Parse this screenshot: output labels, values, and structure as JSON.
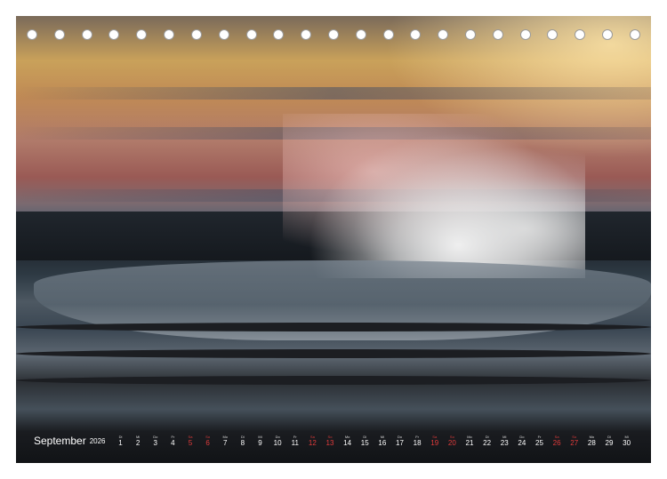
{
  "calendar": {
    "month": "September",
    "year": "2026",
    "days": [
      {
        "num": "1",
        "wd": "Di",
        "weekend": false
      },
      {
        "num": "2",
        "wd": "Mi",
        "weekend": false
      },
      {
        "num": "3",
        "wd": "Do",
        "weekend": false
      },
      {
        "num": "4",
        "wd": "Fr",
        "weekend": false
      },
      {
        "num": "5",
        "wd": "Sa",
        "weekend": true
      },
      {
        "num": "6",
        "wd": "So",
        "weekend": true
      },
      {
        "num": "7",
        "wd": "Mo",
        "weekend": false
      },
      {
        "num": "8",
        "wd": "Di",
        "weekend": false
      },
      {
        "num": "9",
        "wd": "Mi",
        "weekend": false
      },
      {
        "num": "10",
        "wd": "Do",
        "weekend": false
      },
      {
        "num": "11",
        "wd": "Fr",
        "weekend": false
      },
      {
        "num": "12",
        "wd": "Sa",
        "weekend": true
      },
      {
        "num": "13",
        "wd": "So",
        "weekend": true
      },
      {
        "num": "14",
        "wd": "Mo",
        "weekend": false
      },
      {
        "num": "15",
        "wd": "Di",
        "weekend": false
      },
      {
        "num": "16",
        "wd": "Mi",
        "weekend": false
      },
      {
        "num": "17",
        "wd": "Do",
        "weekend": false
      },
      {
        "num": "18",
        "wd": "Fr",
        "weekend": false
      },
      {
        "num": "19",
        "wd": "Sa",
        "weekend": true
      },
      {
        "num": "20",
        "wd": "So",
        "weekend": true
      },
      {
        "num": "21",
        "wd": "Mo",
        "weekend": false
      },
      {
        "num": "22",
        "wd": "Di",
        "weekend": false
      },
      {
        "num": "23",
        "wd": "Mi",
        "weekend": false
      },
      {
        "num": "24",
        "wd": "Do",
        "weekend": false
      },
      {
        "num": "25",
        "wd": "Fr",
        "weekend": false
      },
      {
        "num": "26",
        "wd": "Sa",
        "weekend": true
      },
      {
        "num": "27",
        "wd": "So",
        "weekend": true
      },
      {
        "num": "28",
        "wd": "Mo",
        "weekend": false
      },
      {
        "num": "29",
        "wd": "Di",
        "weekend": false
      },
      {
        "num": "30",
        "wd": "Mi",
        "weekend": false
      }
    ]
  },
  "colors": {
    "weekend": "#e23b3b",
    "text": "#ffffff"
  },
  "binding": {
    "hole_count": 23
  }
}
